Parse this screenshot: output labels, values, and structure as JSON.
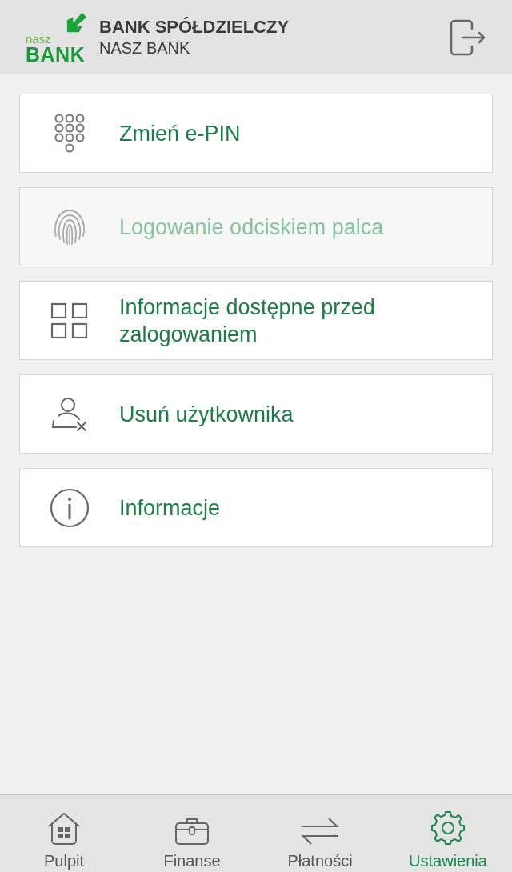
{
  "header": {
    "logo_small": "nasz",
    "logo_big": "BANK",
    "title": "BANK SPÓŁDZIELCZY",
    "subtitle": "NASZ BANK"
  },
  "menu": [
    {
      "kind": "keypad",
      "label": "Zmień e-PIN",
      "disabled": false
    },
    {
      "kind": "fingerprint",
      "label": "Logowanie odciskiem palca",
      "disabled": true
    },
    {
      "kind": "grid",
      "label": "Informacje dostępne przed zalogowaniem",
      "disabled": false
    },
    {
      "kind": "user-remove",
      "label": "Usuń użytkownika",
      "disabled": false
    },
    {
      "kind": "info",
      "label": "Informacje",
      "disabled": false
    }
  ],
  "tabs": [
    {
      "kind": "home",
      "label": "Pulpit",
      "selected": false
    },
    {
      "kind": "briefcase",
      "label": "Finanse",
      "selected": false
    },
    {
      "kind": "transfer",
      "label": "Płatności",
      "selected": false
    },
    {
      "kind": "gear",
      "label": "Ustawienia",
      "selected": true
    }
  ]
}
